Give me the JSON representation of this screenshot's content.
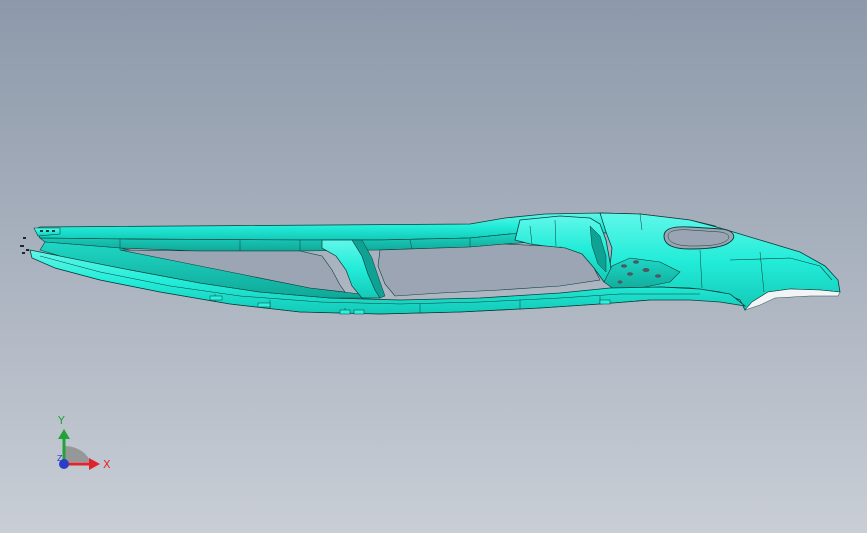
{
  "viewport": {
    "background_top": "#8d99aa",
    "background_bottom": "#c9ced6",
    "part_color": "#22ecd8",
    "edge_color": "#0b3f3b"
  },
  "triad": {
    "x_label": "X",
    "y_label": "Y",
    "z_label": "Z",
    "x_color": "#e0242b",
    "y_color": "#22a23a",
    "z_color": "#2a3cc8"
  }
}
